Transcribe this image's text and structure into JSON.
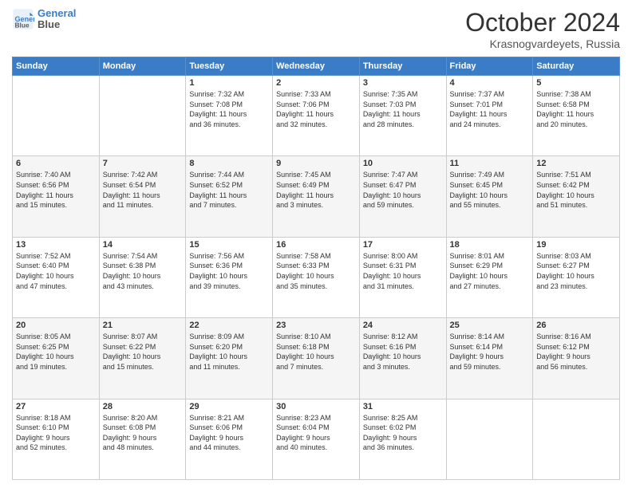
{
  "header": {
    "logo_line1": "General",
    "logo_line2": "Blue",
    "month_title": "October 2024",
    "location": "Krasnogvardeyets, Russia"
  },
  "days_of_week": [
    "Sunday",
    "Monday",
    "Tuesday",
    "Wednesday",
    "Thursday",
    "Friday",
    "Saturday"
  ],
  "weeks": [
    [
      {
        "day": "",
        "info": ""
      },
      {
        "day": "",
        "info": ""
      },
      {
        "day": "1",
        "info": "Sunrise: 7:32 AM\nSunset: 7:08 PM\nDaylight: 11 hours\nand 36 minutes."
      },
      {
        "day": "2",
        "info": "Sunrise: 7:33 AM\nSunset: 7:06 PM\nDaylight: 11 hours\nand 32 minutes."
      },
      {
        "day": "3",
        "info": "Sunrise: 7:35 AM\nSunset: 7:03 PM\nDaylight: 11 hours\nand 28 minutes."
      },
      {
        "day": "4",
        "info": "Sunrise: 7:37 AM\nSunset: 7:01 PM\nDaylight: 11 hours\nand 24 minutes."
      },
      {
        "day": "5",
        "info": "Sunrise: 7:38 AM\nSunset: 6:58 PM\nDaylight: 11 hours\nand 20 minutes."
      }
    ],
    [
      {
        "day": "6",
        "info": "Sunrise: 7:40 AM\nSunset: 6:56 PM\nDaylight: 11 hours\nand 15 minutes."
      },
      {
        "day": "7",
        "info": "Sunrise: 7:42 AM\nSunset: 6:54 PM\nDaylight: 11 hours\nand 11 minutes."
      },
      {
        "day": "8",
        "info": "Sunrise: 7:44 AM\nSunset: 6:52 PM\nDaylight: 11 hours\nand 7 minutes."
      },
      {
        "day": "9",
        "info": "Sunrise: 7:45 AM\nSunset: 6:49 PM\nDaylight: 11 hours\nand 3 minutes."
      },
      {
        "day": "10",
        "info": "Sunrise: 7:47 AM\nSunset: 6:47 PM\nDaylight: 10 hours\nand 59 minutes."
      },
      {
        "day": "11",
        "info": "Sunrise: 7:49 AM\nSunset: 6:45 PM\nDaylight: 10 hours\nand 55 minutes."
      },
      {
        "day": "12",
        "info": "Sunrise: 7:51 AM\nSunset: 6:42 PM\nDaylight: 10 hours\nand 51 minutes."
      }
    ],
    [
      {
        "day": "13",
        "info": "Sunrise: 7:52 AM\nSunset: 6:40 PM\nDaylight: 10 hours\nand 47 minutes."
      },
      {
        "day": "14",
        "info": "Sunrise: 7:54 AM\nSunset: 6:38 PM\nDaylight: 10 hours\nand 43 minutes."
      },
      {
        "day": "15",
        "info": "Sunrise: 7:56 AM\nSunset: 6:36 PM\nDaylight: 10 hours\nand 39 minutes."
      },
      {
        "day": "16",
        "info": "Sunrise: 7:58 AM\nSunset: 6:33 PM\nDaylight: 10 hours\nand 35 minutes."
      },
      {
        "day": "17",
        "info": "Sunrise: 8:00 AM\nSunset: 6:31 PM\nDaylight: 10 hours\nand 31 minutes."
      },
      {
        "day": "18",
        "info": "Sunrise: 8:01 AM\nSunset: 6:29 PM\nDaylight: 10 hours\nand 27 minutes."
      },
      {
        "day": "19",
        "info": "Sunrise: 8:03 AM\nSunset: 6:27 PM\nDaylight: 10 hours\nand 23 minutes."
      }
    ],
    [
      {
        "day": "20",
        "info": "Sunrise: 8:05 AM\nSunset: 6:25 PM\nDaylight: 10 hours\nand 19 minutes."
      },
      {
        "day": "21",
        "info": "Sunrise: 8:07 AM\nSunset: 6:22 PM\nDaylight: 10 hours\nand 15 minutes."
      },
      {
        "day": "22",
        "info": "Sunrise: 8:09 AM\nSunset: 6:20 PM\nDaylight: 10 hours\nand 11 minutes."
      },
      {
        "day": "23",
        "info": "Sunrise: 8:10 AM\nSunset: 6:18 PM\nDaylight: 10 hours\nand 7 minutes."
      },
      {
        "day": "24",
        "info": "Sunrise: 8:12 AM\nSunset: 6:16 PM\nDaylight: 10 hours\nand 3 minutes."
      },
      {
        "day": "25",
        "info": "Sunrise: 8:14 AM\nSunset: 6:14 PM\nDaylight: 9 hours\nand 59 minutes."
      },
      {
        "day": "26",
        "info": "Sunrise: 8:16 AM\nSunset: 6:12 PM\nDaylight: 9 hours\nand 56 minutes."
      }
    ],
    [
      {
        "day": "27",
        "info": "Sunrise: 8:18 AM\nSunset: 6:10 PM\nDaylight: 9 hours\nand 52 minutes."
      },
      {
        "day": "28",
        "info": "Sunrise: 8:20 AM\nSunset: 6:08 PM\nDaylight: 9 hours\nand 48 minutes."
      },
      {
        "day": "29",
        "info": "Sunrise: 8:21 AM\nSunset: 6:06 PM\nDaylight: 9 hours\nand 44 minutes."
      },
      {
        "day": "30",
        "info": "Sunrise: 8:23 AM\nSunset: 6:04 PM\nDaylight: 9 hours\nand 40 minutes."
      },
      {
        "day": "31",
        "info": "Sunrise: 8:25 AM\nSunset: 6:02 PM\nDaylight: 9 hours\nand 36 minutes."
      },
      {
        "day": "",
        "info": ""
      },
      {
        "day": "",
        "info": ""
      }
    ]
  ]
}
